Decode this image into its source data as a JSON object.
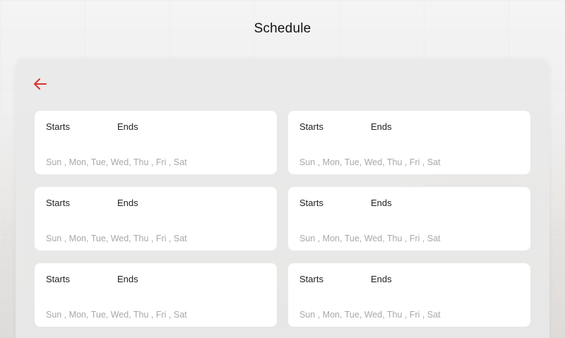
{
  "header": {
    "title": "Schedule"
  },
  "icons": {
    "back": "arrow-left-icon"
  },
  "colors": {
    "accent": "#d9342b"
  },
  "schedules": [
    {
      "starts_label": "Starts",
      "ends_label": "Ends",
      "days": "Sun , Mon, Tue, Wed, Thu , Fri , Sat"
    },
    {
      "starts_label": "Starts",
      "ends_label": "Ends",
      "days": "Sun , Mon, Tue, Wed, Thu , Fri , Sat"
    },
    {
      "starts_label": "Starts",
      "ends_label": "Ends",
      "days": "Sun , Mon, Tue, Wed, Thu , Fri , Sat"
    },
    {
      "starts_label": "Starts",
      "ends_label": "Ends",
      "days": "Sun , Mon, Tue, Wed, Thu , Fri , Sat"
    },
    {
      "starts_label": "Starts",
      "ends_label": "Ends",
      "days": "Sun , Mon, Tue, Wed, Thu , Fri , Sat"
    },
    {
      "starts_label": "Starts",
      "ends_label": "Ends",
      "days": "Sun , Mon, Tue, Wed, Thu , Fri , Sat"
    }
  ]
}
